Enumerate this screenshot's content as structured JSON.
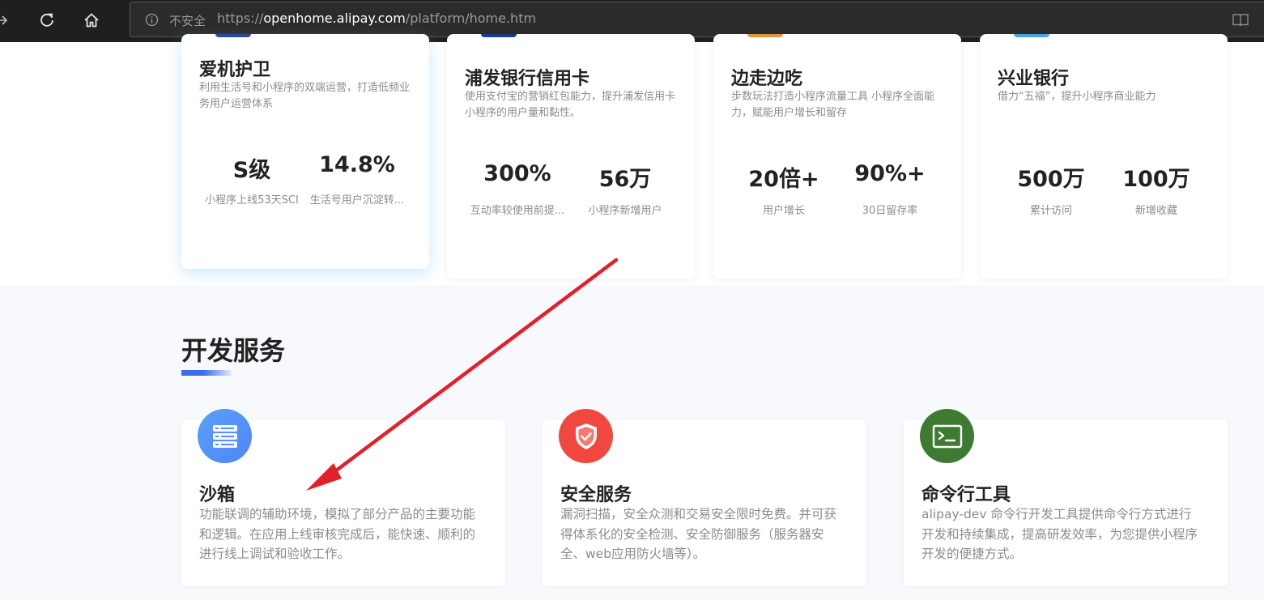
{
  "browser": {
    "insecure_label": "不安全",
    "url_prefix": "https://",
    "url_host": "openhome.alipay.com",
    "url_path": "/platform/home.htm",
    "icons": [
      "forward-arrow-icon",
      "refresh-icon",
      "home-icon",
      "info-icon",
      "reader-mode-icon"
    ]
  },
  "cases": [
    {
      "title": "爱机护卫",
      "description": "利用生活号和小程序的双端运营，打造低频业务用户运营体系",
      "accent_color": "#2b4a9a",
      "metrics": [
        {
          "value": "S级",
          "label": "小程序上线53天SCI"
        },
        {
          "value": "14.8%",
          "label": "生活号用户沉淀转..."
        }
      ]
    },
    {
      "title": "浦发银行信用卡",
      "description": "使用支付宝的营销红包能力，提升浦发信用卡小程序的用户量和黏性。",
      "accent_color": "#1e3a8a",
      "metrics": [
        {
          "value": "300%",
          "label": "互动率较使用前提..."
        },
        {
          "value": "56万",
          "label": "小程序新增用户"
        }
      ]
    },
    {
      "title": "边走边吃",
      "description": "步数玩法打造小程序流量工具 小程序全面能力，赋能用户增长和留存",
      "accent_color": "#e8933a",
      "metrics": [
        {
          "value": "20倍+",
          "label": "用户增长"
        },
        {
          "value": "90%+",
          "label": "30日留存率"
        }
      ]
    },
    {
      "title": "兴业银行",
      "description": "借力“五福”，提升小程序商业能力",
      "accent_color": "#4aa3e8",
      "metrics": [
        {
          "value": "500万",
          "label": "累计访问"
        },
        {
          "value": "100万",
          "label": "新增收藏"
        }
      ]
    }
  ],
  "dev_services": {
    "title": "开发服务",
    "items": [
      {
        "title": "沙箱",
        "description": "功能联调的辅助环境，模拟了部分产品的主要功能和逻辑。在应用上线审核完成后，能快速、顺利的进行线上调试和验收工作。",
        "icon": "server-icon",
        "icon_color": "#4f86f7"
      },
      {
        "title": "安全服务",
        "description": "漏洞扫描，安全众测和交易安全限时免费。并可获得体系化的安全检测、安全防御服务（服务器安全、web应用防火墙等）。",
        "icon": "shield-check-icon",
        "icon_color": "#f0483e"
      },
      {
        "title": "命令行工具",
        "description": "alipay-dev 命令行开发工具提供命令行方式进行开发和持续集成，提高研发效率，为您提供小程序开发的便捷方式。",
        "icon": "terminal-icon",
        "icon_color": "#3f7a33"
      }
    ]
  },
  "annotation": {
    "arrow_color": "#e3202a",
    "points_to": "沙箱"
  }
}
